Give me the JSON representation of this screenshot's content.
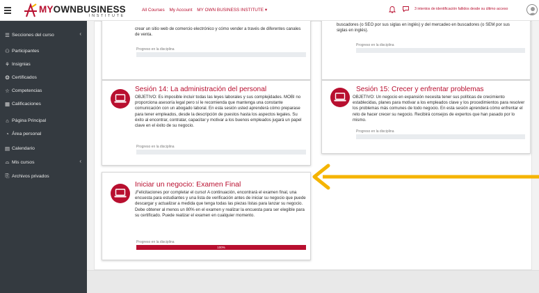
{
  "header": {
    "logo_main": "MYOWNBUSINESS",
    "logo_my": "MY",
    "logo_rest": "OWNBUSINESS",
    "logo_sub": "INSTITUTE",
    "nav": [
      "All Courses",
      "My Account",
      "MY OWN BUSINESS INSTITUTE ▾"
    ],
    "login_message": "3 intentos de identificación fallidos desde su último acceso",
    "icons": [
      "menu-icon",
      "bell-icon",
      "chat-icon",
      "user-icon"
    ]
  },
  "sidebar": {
    "items": [
      {
        "icon": "list-icon",
        "glyph": "☰",
        "label": "Secciones del curso",
        "chevron": "‹"
      },
      {
        "icon": "users-icon",
        "glyph": "⚇",
        "label": "Participantes"
      },
      {
        "icon": "badge-icon",
        "glyph": "⚘",
        "label": "Insignias"
      },
      {
        "icon": "certificate-icon",
        "glyph": "❂",
        "label": "Certificados"
      },
      {
        "icon": "star-icon",
        "glyph": "☆",
        "label": "Competencias"
      },
      {
        "icon": "grid-icon",
        "glyph": "▦",
        "label": "Calificaciones"
      },
      {
        "icon": "home-icon",
        "glyph": "⌂",
        "label": "Página Principal"
      },
      {
        "icon": "dashboard-icon",
        "glyph": "◔",
        "label": "Área personal"
      },
      {
        "icon": "calendar-icon",
        "glyph": "▤",
        "label": "Calendario"
      },
      {
        "icon": "graduation-icon",
        "glyph": "⌓",
        "label": "Mis cursos",
        "chevron": "‹"
      },
      {
        "icon": "file-icon",
        "glyph": "⎘",
        "label": "Archivos privados"
      }
    ]
  },
  "cards": {
    "top_left": {
      "text": "crear un sitio web de comercio electrónico y cómo vender a través de diferentes canales de venta.",
      "progress_label": "Progreso en la disciplina",
      "progress": 0
    },
    "top_right": {
      "text": "buscadores (o SEO por sus siglas en inglés) y del mercadeo en buscadores (o SEM por sus siglas en inglés).",
      "progress_label": "Progreso en la disciplina",
      "progress": 0
    },
    "session14": {
      "title": "Sesión 14: La administración del personal",
      "text": "OBJETIVO: Es imposible incluir todas las leyes laborales y sus complejidades. MOBI no proporciona asesoría legal pero sí le recomienda que mantenga una constante comunicación con un abogado laboral. En esta sesión usted aprenderá cómo preparase para tener empleados, desde la descripción de puestos hasta los aspectos legales. Su éxito al encontrar, contratar, capacitar y motivar a los buenos empleados jugará un papel clave en el éxito de su negocio.",
      "progress_label": "Progreso en la disciplina",
      "progress": 0
    },
    "session15": {
      "title": "Sesión 15: Crecer y enfrentar problemas",
      "text": "OBJETIVO: Un negocio en expansión necesita tener sus políticas de crecimiento establecidas, planes para motivar a los empleados clave y los procedimientos para resolver los problemas más comunes de todo negocio. En esta sesión aprenderá cómo enfrentar el reto de hacer crecer su negocio. Recibirá consejos de expertos que han pasado por lo mismo.",
      "progress_label": "Progreso en la disciplina",
      "progress": 0
    },
    "final_exam": {
      "title": "Iniciar un negocio: Examen Final",
      "text": "¡Felicitaciones por completar el curso! A continuación, encontrará el examen final, una encuesta para estudiantes y una lista de verificación antes de iniciar su negocio que puede descargar y actualizar a medida que tenga todas las piezas listas para lanzar su negocio. Debe obtener al menos un 80% en el examen y realizar la encuesta para ser elegible para su certificado. Puede realizar el examen en cualquier momento.",
      "progress_label": "Progreso en la disciplina",
      "progress": 1.0,
      "progress_text": "100%"
    }
  },
  "annotation": {
    "arrow_color": "#f5b400"
  },
  "colors": {
    "accent": "#b80f2f",
    "sidebar_bg": "#343a40",
    "arrow": "#f5b400"
  }
}
